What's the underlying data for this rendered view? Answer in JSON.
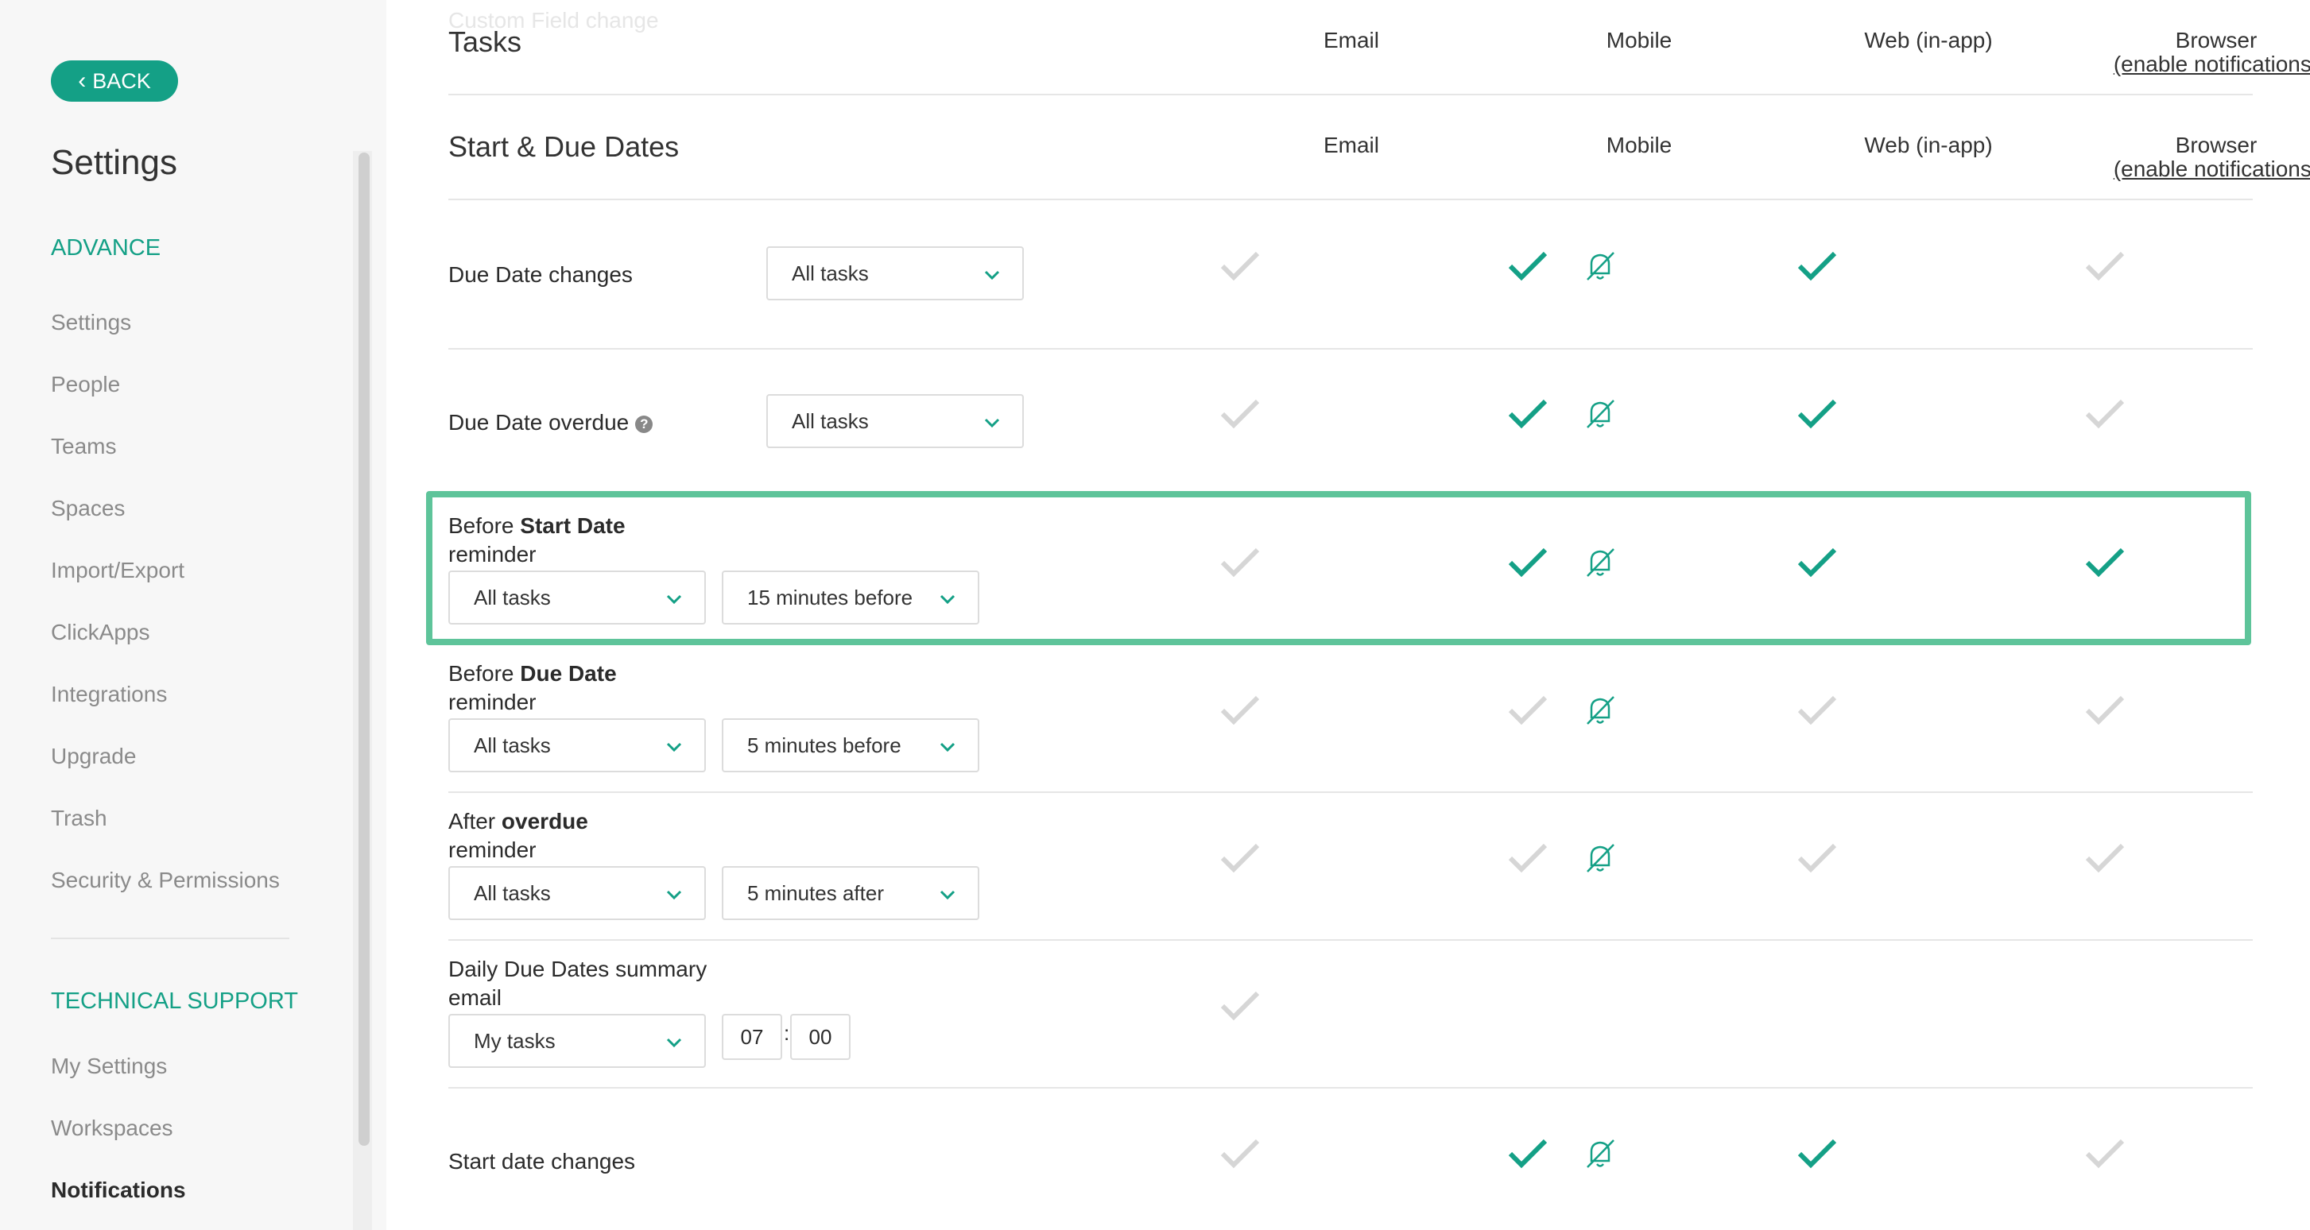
{
  "sidebar": {
    "back_label": "BACK",
    "title": "Settings",
    "section_advance": "ADVANCE",
    "advance_items": [
      "Settings",
      "People",
      "Teams",
      "Spaces",
      "Import/Export",
      "ClickApps",
      "Integrations",
      "Upgrade",
      "Trash",
      "Security & Permissions"
    ],
    "section_support": "TECHNICAL SUPPORT",
    "support_items": [
      "My Settings",
      "Workspaces",
      "Notifications"
    ],
    "active_item": "Notifications"
  },
  "header": {
    "faded_text": "Custom Field change",
    "tasks_title": "Tasks",
    "dates_title": "Start & Due Dates",
    "col_email": "Email",
    "col_mobile": "Mobile",
    "col_web": "Web (in-app)",
    "col_browser": "Browser",
    "enable_link": "(enable notifications)"
  },
  "rows": {
    "due_date_changes": {
      "label": "Due Date changes",
      "select": "All tasks"
    },
    "due_date_overdue": {
      "label": "Due Date overdue",
      "select": "All tasks"
    },
    "before_start": {
      "prefix": "Before ",
      "bold": "Start Date",
      "suffix": "reminder",
      "select": "All tasks",
      "when": "15 minutes before"
    },
    "before_due": {
      "prefix": "Before ",
      "bold": "Due Date",
      "suffix": "reminder",
      "select": "All tasks",
      "when": "5 minutes before"
    },
    "after_overdue": {
      "prefix": "After ",
      "bold": "overdue",
      "suffix": "reminder",
      "select": "All tasks",
      "when": "5 minutes after"
    },
    "daily_summary": {
      "line1": "Daily Due Dates summary",
      "line2": "email",
      "select": "My tasks",
      "hour": "07",
      "separator": ":",
      "minute": "00"
    },
    "start_date_changes": {
      "label": "Start date changes"
    }
  },
  "colors": {
    "accent": "#14a086",
    "check_on": "#14a086",
    "check_off": "#d6d6d6",
    "highlight": "#5ec49a"
  },
  "icons": [
    "chevron-left-icon",
    "chevron-down-icon",
    "check-icon",
    "bell-off-icon",
    "question-icon"
  ]
}
